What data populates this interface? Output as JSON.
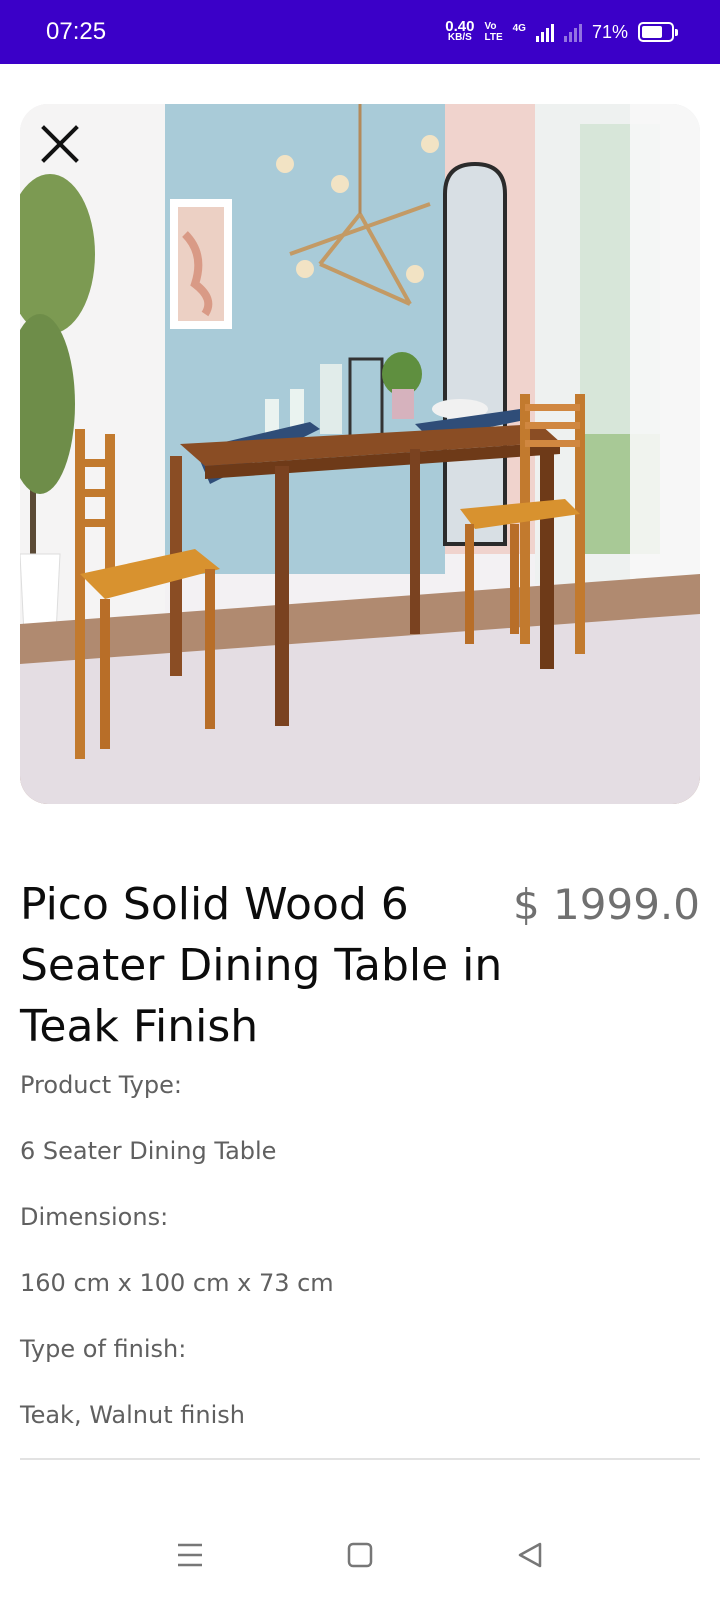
{
  "status_bar": {
    "time": "07:25",
    "net_speed_value": "0.40",
    "net_speed_unit": "KB/S",
    "volte_top": "Vo",
    "volte_bottom": "LTE",
    "network_label": "4G",
    "battery_percent": "71%",
    "battery_level": 0.71,
    "background_color": "#3b00c8"
  },
  "hero": {
    "close_icon": "close-icon",
    "image_subject": "dining-room-photo"
  },
  "product": {
    "title": "Pico Solid Wood 6 Seater Dining Table in Teak Finish",
    "price": "$ 1999.0",
    "details": [
      "Product Type:",
      "6 Seater Dining Table",
      "Dimensions:",
      "160 cm x 100 cm x 73 cm",
      "Type of finish:",
      "Teak, Walnut finish"
    ]
  },
  "nav_bar": {
    "icons": [
      "menu-icon",
      "home-square-icon",
      "back-triangle-icon"
    ]
  }
}
